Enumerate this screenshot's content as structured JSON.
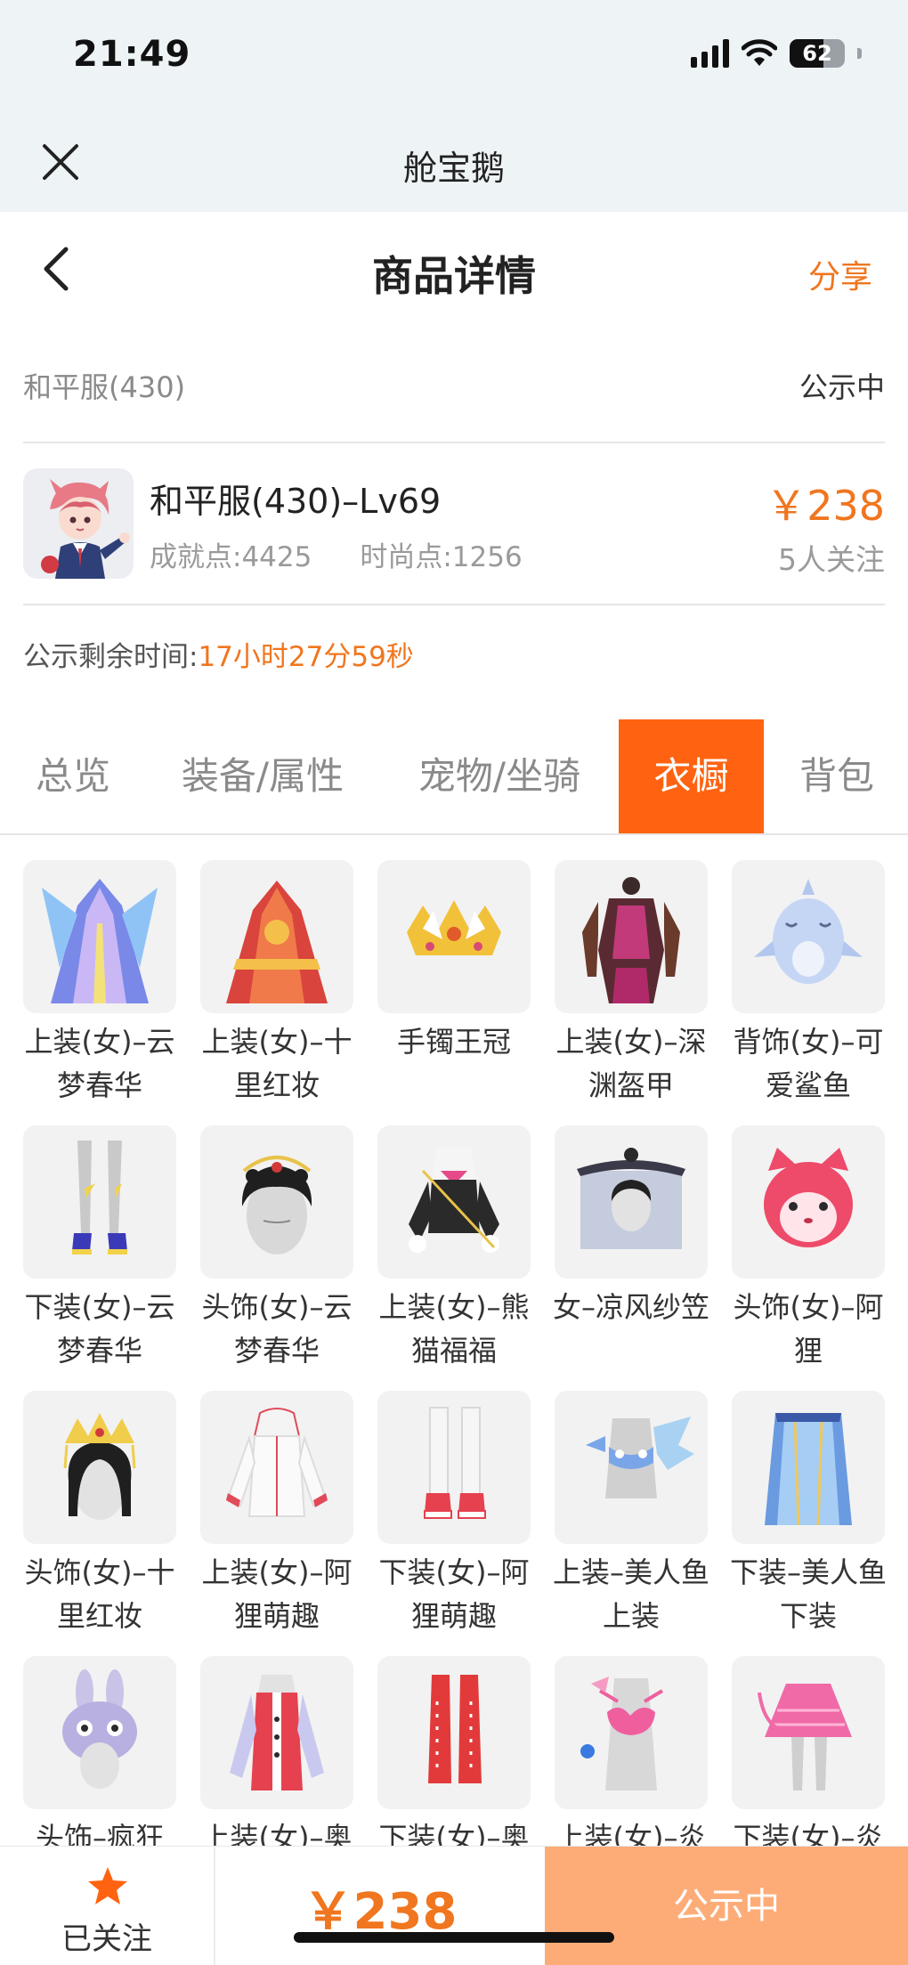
{
  "status": {
    "time": "21:49",
    "battery": "62",
    "battery_level": 0.62
  },
  "mini_nav": {
    "title": "舱宝鹅"
  },
  "header": {
    "title": "商品详情",
    "share": "分享"
  },
  "server": {
    "name": "和平服(430)",
    "status": "公示中"
  },
  "account": {
    "title": "和平服(430)–Lv69",
    "achievement": "成就点:4425",
    "fashion": "时尚点:1256",
    "price": "￥238",
    "followers": "5人关注"
  },
  "timer": {
    "label": "公示剩余时间:",
    "value": "17小时27分59秒"
  },
  "tabs": [
    {
      "label": "总览"
    },
    {
      "label": "装备/属性"
    },
    {
      "label": "宠物/坐骑"
    },
    {
      "label": "衣橱",
      "active": true
    },
    {
      "label": "背包"
    }
  ],
  "items": [
    {
      "label": "上装(女)–云梦春华",
      "icon": "outfit-blue-gown-icon"
    },
    {
      "label": "上装(女)–十里红妆",
      "icon": "outfit-red-bridal-icon"
    },
    {
      "label": "手镯王冠",
      "icon": "bracelet-crown-icon"
    },
    {
      "label": "上装(女)–深渊盔甲",
      "icon": "outfit-abyss-armor-icon"
    },
    {
      "label": "背饰(女)–可爱鲨鱼",
      "icon": "shark-backpack-icon"
    },
    {
      "label": "下装(女)–云梦春华",
      "icon": "legs-heels-icon"
    },
    {
      "label": "头饰(女)–云梦春华",
      "icon": "headdress-gold-icon"
    },
    {
      "label": "上装(女)–熊猫福福",
      "icon": "outfit-panda-icon"
    },
    {
      "label": "女–凉风纱笠",
      "icon": "veil-hat-icon"
    },
    {
      "label": "头饰(女)–阿狸",
      "icon": "ahri-fox-head-icon"
    },
    {
      "label": "头饰(女)–十里红妆",
      "icon": "headdress-crown-icon"
    },
    {
      "label": "上装(女)–阿狸萌趣",
      "icon": "outfit-white-hoodie-icon"
    },
    {
      "label": "下装(女)–阿狸萌趣",
      "icon": "white-boots-icon"
    },
    {
      "label": "上装–美人鱼上装",
      "icon": "mermaid-top-icon"
    },
    {
      "label": "下装–美人鱼下装",
      "icon": "mermaid-skirt-icon"
    },
    {
      "label": "头饰–疯狂",
      "icon": "bunny-hat-icon"
    },
    {
      "label": "上装(女)–奥",
      "icon": "outfit-red-jacket-icon"
    },
    {
      "label": "下装(女)–奥",
      "icon": "red-boots-icon"
    },
    {
      "label": "上装(女)–炎",
      "icon": "pink-bikini-top-icon"
    },
    {
      "label": "下装(女)–炎",
      "icon": "pink-skirt-icon"
    }
  ],
  "bottom": {
    "follow_label": "已关注",
    "price": "￥238",
    "action": "公示中"
  },
  "colors": {
    "accent": "#f0761f",
    "tab_active": "#ff6311",
    "action_bg": "#fdac78"
  }
}
